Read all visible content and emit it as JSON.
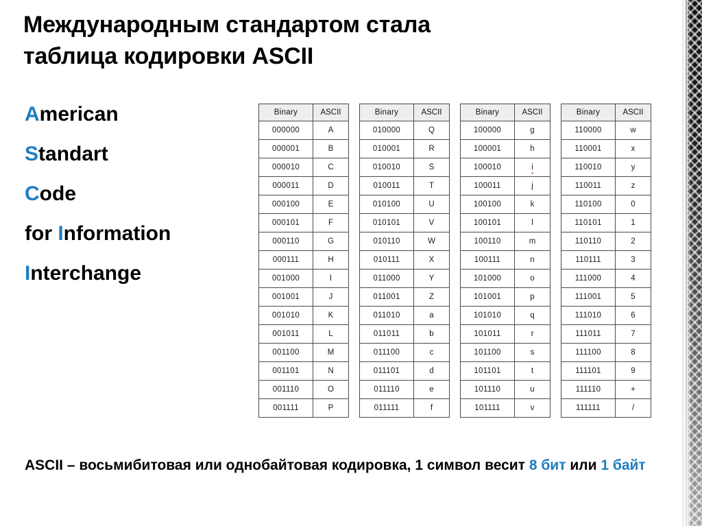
{
  "slide": {
    "heading_line1": "Международным стандартом стала",
    "heading_line2": "таблица кодировки ASCII",
    "accent_color": "#1F7DC0"
  },
  "acronym": {
    "lines": [
      {
        "highlight": "A",
        "rest": "merican"
      },
      {
        "highlight": "S",
        "rest": "tandart"
      },
      {
        "highlight": "C",
        "rest": "ode"
      },
      {
        "prefix": "for ",
        "highlight": "I",
        "rest": "nformation"
      },
      {
        "highlight": "I",
        "rest": "nterchange"
      }
    ]
  },
  "tables": {
    "headers": [
      "Binary",
      "ASCII"
    ],
    "columns": [
      {
        "rows": [
          {
            "binary": "000000",
            "ascii": "A"
          },
          {
            "binary": "000001",
            "ascii": "B"
          },
          {
            "binary": "000010",
            "ascii": "C"
          },
          {
            "binary": "000011",
            "ascii": "D"
          },
          {
            "binary": "000100",
            "ascii": "E"
          },
          {
            "binary": "000101",
            "ascii": "F"
          },
          {
            "binary": "000110",
            "ascii": "G"
          },
          {
            "binary": "000111",
            "ascii": "H"
          },
          {
            "binary": "001000",
            "ascii": "I"
          },
          {
            "binary": "001001",
            "ascii": "J"
          },
          {
            "binary": "001010",
            "ascii": "K"
          },
          {
            "binary": "001011",
            "ascii": "L"
          },
          {
            "binary": "001100",
            "ascii": "M"
          },
          {
            "binary": "001101",
            "ascii": "N"
          },
          {
            "binary": "001110",
            "ascii": "O"
          },
          {
            "binary": "001111",
            "ascii": "P"
          }
        ]
      },
      {
        "rows": [
          {
            "binary": "010000",
            "ascii": "Q"
          },
          {
            "binary": "010001",
            "ascii": "R"
          },
          {
            "binary": "010010",
            "ascii": "S"
          },
          {
            "binary": "010011",
            "ascii": "T"
          },
          {
            "binary": "010100",
            "ascii": "U"
          },
          {
            "binary": "010101",
            "ascii": "V"
          },
          {
            "binary": "010110",
            "ascii": "W"
          },
          {
            "binary": "010111",
            "ascii": "X"
          },
          {
            "binary": "011000",
            "ascii": "Y"
          },
          {
            "binary": "011001",
            "ascii": "Z"
          },
          {
            "binary": "011010",
            "ascii": "a"
          },
          {
            "binary": "011011",
            "ascii": "b"
          },
          {
            "binary": "011100",
            "ascii": "c"
          },
          {
            "binary": "011101",
            "ascii": "d"
          },
          {
            "binary": "011110",
            "ascii": "e"
          },
          {
            "binary": "011111",
            "ascii": "f"
          }
        ]
      },
      {
        "rows": [
          {
            "binary": "100000",
            "ascii": "g"
          },
          {
            "binary": "100001",
            "ascii": "h"
          },
          {
            "binary": "100010",
            "ascii": "i",
            "spellcheck_flag": true
          },
          {
            "binary": "100011",
            "ascii": "j"
          },
          {
            "binary": "100100",
            "ascii": "k"
          },
          {
            "binary": "100101",
            "ascii": "l"
          },
          {
            "binary": "100110",
            "ascii": "m"
          },
          {
            "binary": "100111",
            "ascii": "n"
          },
          {
            "binary": "101000",
            "ascii": "o"
          },
          {
            "binary": "101001",
            "ascii": "p"
          },
          {
            "binary": "101010",
            "ascii": "q"
          },
          {
            "binary": "101011",
            "ascii": "r"
          },
          {
            "binary": "101100",
            "ascii": "s"
          },
          {
            "binary": "101101",
            "ascii": "t"
          },
          {
            "binary": "101110",
            "ascii": "u"
          },
          {
            "binary": "101111",
            "ascii": "v"
          }
        ]
      },
      {
        "rows": [
          {
            "binary": "110000",
            "ascii": "w"
          },
          {
            "binary": "110001",
            "ascii": "x"
          },
          {
            "binary": "110010",
            "ascii": "y"
          },
          {
            "binary": "110011",
            "ascii": "z"
          },
          {
            "binary": "110100",
            "ascii": "0"
          },
          {
            "binary": "110101",
            "ascii": "1"
          },
          {
            "binary": "110110",
            "ascii": "2"
          },
          {
            "binary": "110111",
            "ascii": "3"
          },
          {
            "binary": "111000",
            "ascii": "4"
          },
          {
            "binary": "111001",
            "ascii": "5"
          },
          {
            "binary": "111010",
            "ascii": "6"
          },
          {
            "binary": "111011",
            "ascii": "7"
          },
          {
            "binary": "111100",
            "ascii": "8"
          },
          {
            "binary": "111101",
            "ascii": "9"
          },
          {
            "binary": "111110",
            "ascii": "+"
          },
          {
            "binary": "111111",
            "ascii": "/"
          }
        ]
      }
    ]
  },
  "footer": {
    "part1": "ASCII – восьмибитовая или однобайтовая кодировка, 1 символ весит ",
    "highlight1": "8 бит",
    "part2": " или ",
    "highlight2": "1 байт"
  }
}
